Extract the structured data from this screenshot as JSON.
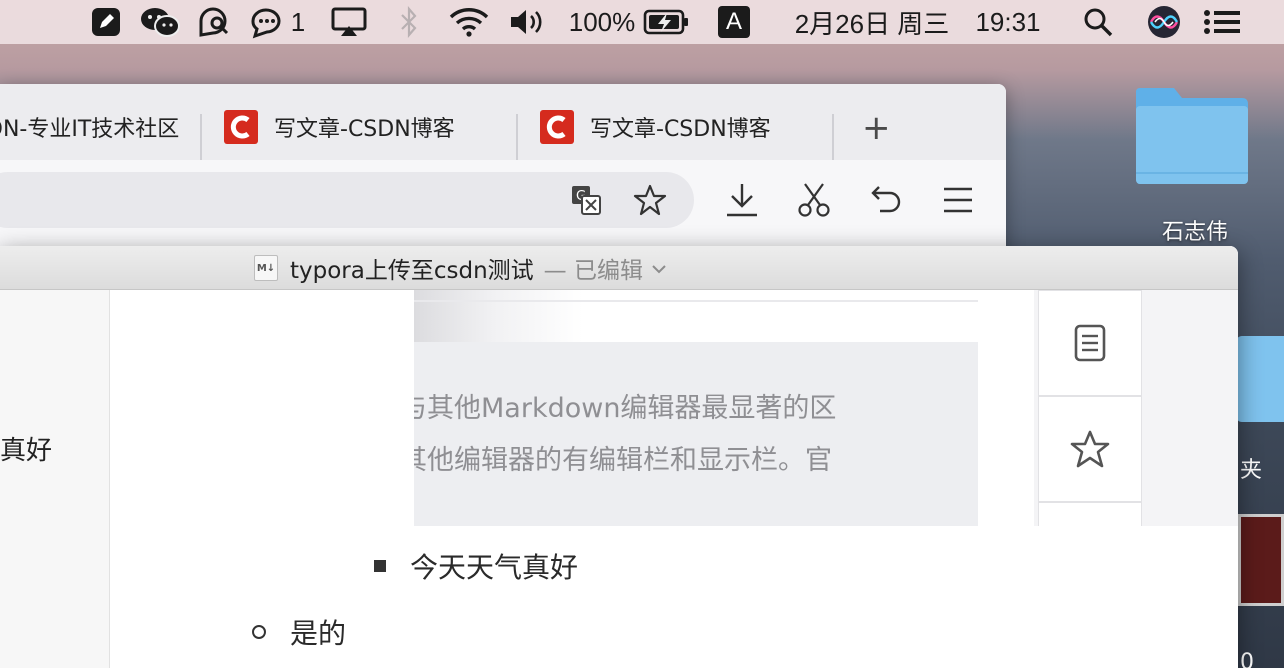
{
  "menubar": {
    "wechat_unread": "1",
    "battery": "100%",
    "input_method": "A",
    "date": "2月26日 周三",
    "time": "19:31"
  },
  "desktop": {
    "folder_label": "石志伟",
    "frag_right_1": "夹",
    "frag_right_2": "0"
  },
  "browser": {
    "tabs": [
      {
        "title": "DN-专业IT技术社区"
      },
      {
        "title": "写文章-CSDN博客"
      },
      {
        "title": "写文章-CSDN博客"
      }
    ],
    "new_tab_label": "+"
  },
  "typora": {
    "title": "typora上传至csdn测试",
    "status": "— 已编辑",
    "sidebar_fragment": "真好",
    "embed_lines": [
      "与其他Markdown编辑器最显著的区",
      "其他编辑器的有编辑栏和显示栏。官"
    ],
    "list_items": [
      {
        "text": "今天天气真好"
      },
      {
        "text": "是的"
      }
    ]
  },
  "colors": {
    "csdn_red": "#d52b1e",
    "folder_blue": "#7fc3ee"
  }
}
